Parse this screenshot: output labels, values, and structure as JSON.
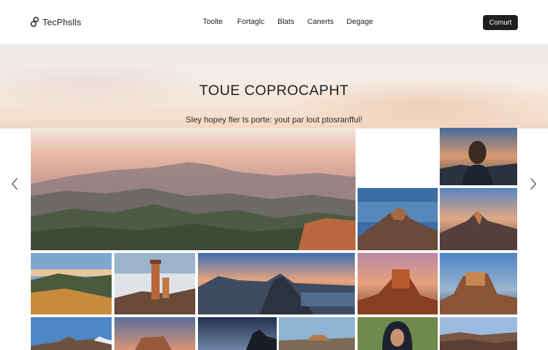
{
  "header": {
    "logo_text": "TecPhslls",
    "nav": [
      "Toolte",
      "Fortaglc",
      "Blats",
      "Canerts",
      "Degage"
    ],
    "contact_label": "Comurt"
  },
  "hero": {
    "title": "TOUE COPROCAPHT",
    "subtitle": "Sley hopey fler ts porte: yout par lout ptosranfful!"
  },
  "gallery": {
    "prev_icon": "chevron-left-icon",
    "next_icon": "chevron-right-icon",
    "photos": [
      "mountain-range-sunset",
      "woman-portrait-dusk",
      "rock-peak-blue-sky",
      "mountain-peak-sunset",
      "grassy-hills",
      "lighthouse-clouds",
      "coastal-mountains",
      "red-rock-formation",
      "butte-at-twilight",
      "mountain-peak-blue",
      "rock-formation-dusk",
      "night-rocks",
      "mesa-landscape",
      "hooded-portrait",
      "canyon-vista"
    ]
  },
  "colors": {
    "accent": "#1f1f1f",
    "hero_peach": "#f3d8c4"
  }
}
